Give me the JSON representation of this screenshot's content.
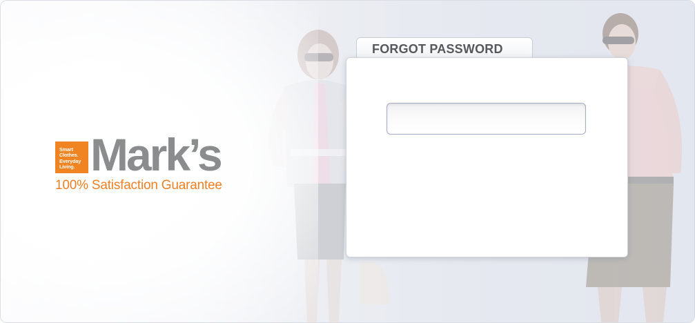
{
  "brand": {
    "box_lines": [
      "Smart",
      "Clothes.",
      "Everyday",
      "Living."
    ],
    "wordmark": "Mark’s",
    "tagline": "100% Satisfaction Guarantee",
    "colors": {
      "orange": "#f08422",
      "gray": "#8a8c8e"
    }
  },
  "form": {
    "tab_label": "FORGOT PASSWORD",
    "email": {
      "value": "",
      "placeholder": ""
    }
  },
  "background": {
    "image": "faded photo of a woman and a man in summer clothing"
  }
}
